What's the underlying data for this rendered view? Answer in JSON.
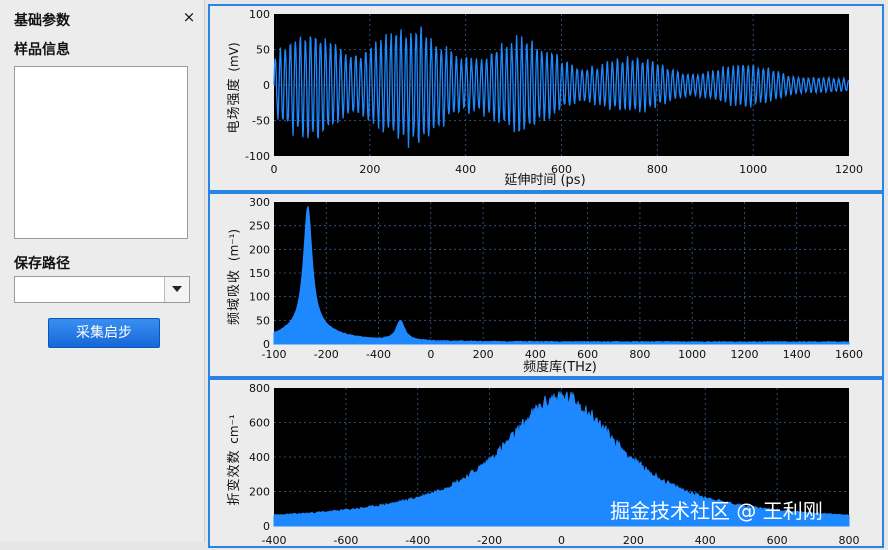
{
  "sidebar": {
    "title": "基础参数",
    "close_glyph": "×",
    "sample_info_label": "样品信息",
    "sample_info_value": "",
    "save_path_label": "保存路径",
    "save_path_value": "",
    "start_button_label": "采集启步"
  },
  "watermark": "掘金技术社区 @ 王利刚",
  "colors": {
    "signal": "#1e88ff",
    "plot_bg": "#000000",
    "accent_border": "#2b82e6",
    "button": "#1a6fe0"
  },
  "chart_data": [
    {
      "type": "line",
      "xlabel": "延伸时间 (ps)",
      "ylabel": "电场强度",
      "ylabel_unit": "(mV)",
      "xlim": [
        0,
        1200
      ],
      "ylim": [
        -100,
        100
      ],
      "xticks": [
        "0",
        "200",
        "400",
        "600",
        "800",
        "1000",
        "1200"
      ],
      "yticks": [
        "100",
        "50",
        "0",
        "-50",
        "-100"
      ],
      "grid": true,
      "envelope": {
        "x": [
          0,
          100,
          200,
          300,
          400,
          500,
          600,
          700,
          800,
          900,
          1000,
          1100,
          1200
        ],
        "amplitude": [
          55,
          80,
          88,
          78,
          72,
          65,
          55,
          40,
          35,
          30,
          28,
          22,
          8
        ]
      }
    },
    {
      "type": "line",
      "xlabel": "频度库(THz)",
      "ylabel": "频域吸收",
      "ylabel_unit": "(m⁻¹)",
      "xlim": [
        -100,
        1600
      ],
      "ylim": [
        0,
        300
      ],
      "xticks": [
        "-100",
        "-200",
        "-400",
        "0",
        "200",
        "400",
        "600",
        "800",
        "1000",
        "1200",
        "1400",
        "1600"
      ],
      "yticks": [
        "300",
        "250",
        "200",
        "150",
        "100",
        "50",
        "0"
      ],
      "grid": true,
      "peaks": [
        {
          "x": -120,
          "y": 52
        },
        {
          "x": 0,
          "y": 285
        },
        {
          "x": 120,
          "y": 52
        }
      ]
    },
    {
      "type": "area",
      "xlabel": "",
      "ylabel": "折变效数",
      "ylabel_unit": "cm⁻¹",
      "xlim": [
        -400,
        800
      ],
      "ylim": [
        0,
        800
      ],
      "xticks": [
        "-400",
        "-600",
        "-400",
        "-200",
        "0",
        "200",
        "400",
        "600",
        "800"
      ],
      "yticks": [
        "800",
        "600",
        "400",
        "200",
        "0"
      ],
      "grid": true,
      "peak": {
        "x": 0,
        "y": 760
      }
    }
  ]
}
